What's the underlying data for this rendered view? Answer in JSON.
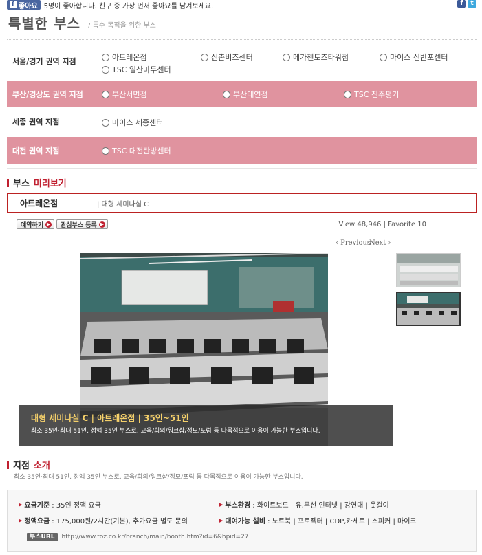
{
  "social": {
    "like_label": "좋아요",
    "like_text": "5명이 좋아합니다. 친구 중 가장 먼저 좋아요를 남겨보세요."
  },
  "page": {
    "title": "특별한 부스",
    "subtitle": "/ 특수 목적을 위한 부스"
  },
  "regions": [
    {
      "label": "서울/경기 권역 지점",
      "options": [
        "아트레온점",
        "신촌비즈센터",
        "메가젠토즈타워점",
        "마이스 신반포센터",
        "TSC 일산마두센터"
      ]
    },
    {
      "label": "부산/경상도 권역 지점",
      "options": [
        "부산서면점",
        "부산대연점",
        "TSC 진주평거"
      ]
    },
    {
      "label": "세종 권역 지점",
      "options": [
        "마이스 세종센터"
      ]
    },
    {
      "label": "대전 권역 지점",
      "options": [
        "TSC 대전탄방센터"
      ]
    }
  ],
  "preview": {
    "heading_main": "부스",
    "heading_accent": "미리보기",
    "booth_name": "아트레온점",
    "booth_desc": "| 대형 세미나실 C",
    "reserve_label": "예약하기",
    "favorite_label": "관심부스 등록",
    "stats": "View 48,946 | Favorite 10",
    "prev_label": "‹ Previous",
    "next_label": "Next ›",
    "caption_title": "대형 세미나실 C | 아트레온점 | 35인~51인",
    "caption_desc": "최소 35인·최대 51인, 정액 35인 부스로, 교육/회의/워크샵/정모/포럼 등 다목적으로 이용이 가능한 부스입니다."
  },
  "branch": {
    "heading_main": "지점",
    "heading_accent": "소개",
    "desc": "최소 35인·최대 51인, 정액 35인 부스로, 교육/회의/워크샵/정모/포럼 등 다목적으로 이용이 가능한 부스입니다.",
    "fee_base_label": "요금기준",
    "fee_base_value": ": 35인 정액 요금",
    "env_label": "부스환경",
    "env_value": ": 화이트보드 | 유,무선 인터넷 | 강연대 | 옷걸이",
    "fixed_fee_label": "정액요금",
    "fixed_fee_value": ": 175,000원/2시간(기본), 추가요금 별도 문의",
    "rental_label": "대여가능 설비",
    "rental_value": ": 노트북 | 프로젝터 | CDP,카세트 | 스피커 | 마이크",
    "url_label": "부스URL",
    "url_value": "http://www.toz.co.kr/branch/main/booth.htm?id=6&bpid=27"
  },
  "colors": {
    "region_pink": "#e0939f",
    "accent_red": "#c02030",
    "caption_gold": "#f5d06a"
  }
}
